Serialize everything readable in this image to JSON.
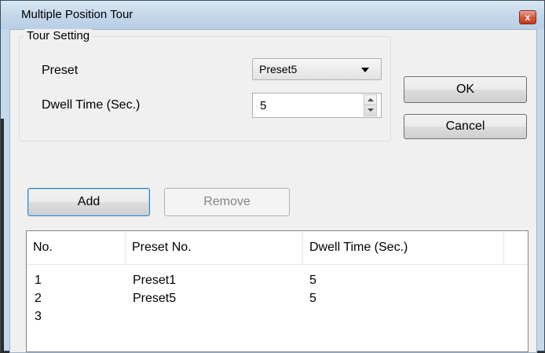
{
  "window": {
    "title": "Multiple Position Tour",
    "close_glyph": "x"
  },
  "tour_setting": {
    "legend": "Tour Setting",
    "preset_label": "Preset",
    "preset_value": "Preset5",
    "dwell_label": "Dwell Time (Sec.)",
    "dwell_value": "5"
  },
  "buttons": {
    "ok": "OK",
    "cancel": "Cancel",
    "add": "Add",
    "remove": "Remove"
  },
  "list": {
    "columns": [
      "No.",
      "Preset No.",
      "Dwell Time (Sec.)"
    ],
    "rows": [
      {
        "no": "1",
        "preset": "Preset1",
        "dwell": "5"
      },
      {
        "no": "2",
        "preset": "Preset5",
        "dwell": "5"
      },
      {
        "no": "3",
        "preset": "",
        "dwell": ""
      }
    ]
  },
  "colors": {
    "title_bar": "#c3d6ea",
    "client_bg": "#f0f0f0",
    "default_button_border": "#3c7fb1",
    "close_button": "#d45a3e"
  }
}
